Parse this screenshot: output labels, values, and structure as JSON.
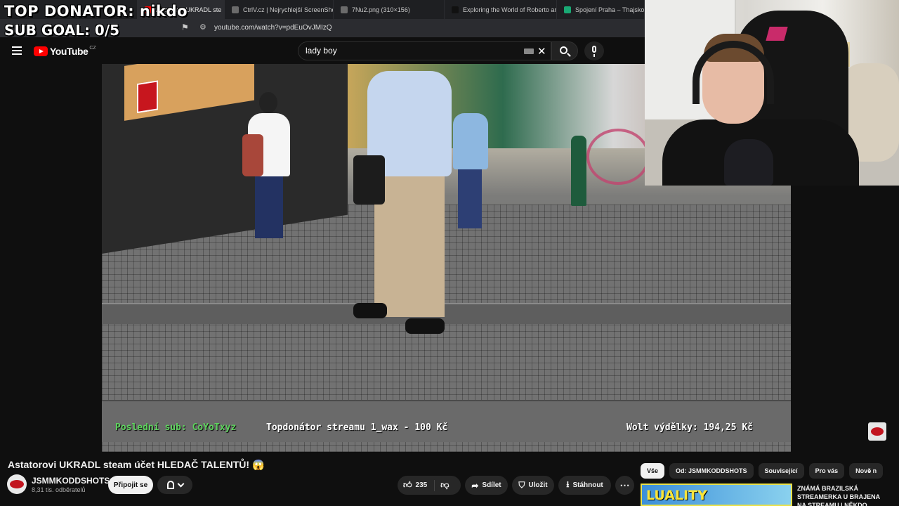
{
  "overlay": {
    "top_donator": "TOP DONATOR: nikdo",
    "sub_goal": "SUB GOAL: 0/5"
  },
  "browser": {
    "tabs": [
      {
        "label": "Astatorovi UKRADL ste",
        "color": "#ff0000"
      },
      {
        "label": "CtrlV.cz | Nejrychlejší ScreenShot a",
        "color": "#6b6b6b"
      },
      {
        "label": "7Nu2.png (310×156)",
        "color": "#6b6b6b"
      },
      {
        "label": "Exploring the World of Roberto and",
        "color": "#111111"
      },
      {
        "label": "Spojení Praha – Thajsko",
        "color": "#19a974"
      }
    ],
    "url": "youtube.com/watch?v=pdEuOvJMIzQ"
  },
  "youtube": {
    "logo_text": "YouTube",
    "country": "CZ",
    "search_value": "lady boy"
  },
  "video_overlay": {
    "last_sub": "Poslední sub: CoYoTxyz",
    "top_donator_stream": "Topdonátor streamu 1_wax - 100 Kč",
    "wolt_earnings": "Wolt výdělky: 194,25 Kč"
  },
  "video": {
    "title": "Astatorovi UKRADL steam účet HLEDAČ TALENTŮ! 😱",
    "channel": "JSMMKODDSHOTS",
    "subscribers": "8,31 tis. odběratelů",
    "subscribe_label": "Připojit se",
    "likes": "235",
    "share_label": "Sdílet",
    "save_label": "Uložit",
    "download_label": "Stáhnout"
  },
  "chips": [
    "Vše",
    "Od: JSMMKODDSHOTS",
    "Související",
    "Pro vás",
    "Nově n"
  ],
  "recommended": {
    "thumb_text": "LUALITY",
    "title": "ZNÁMÁ BRAZILSKÁ STREAMERKA U BRAJENA NA STREAMU | NĚKDO..."
  },
  "colors": {
    "yt_red": "#ff0000",
    "last_sub_green": "#5fd35f",
    "background": "#0f0f0f"
  }
}
